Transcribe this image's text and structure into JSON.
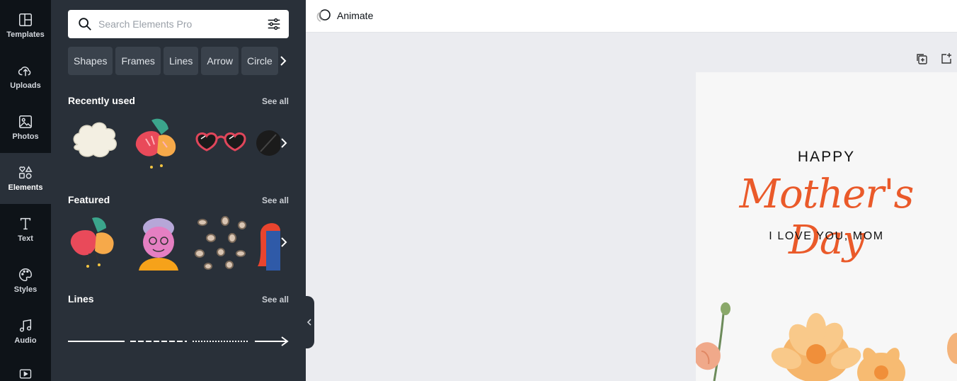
{
  "rail": {
    "items": [
      {
        "label": "Templates",
        "icon": "templates-icon"
      },
      {
        "label": "Uploads",
        "icon": "cloud-upload-icon"
      },
      {
        "label": "Photos",
        "icon": "image-icon"
      },
      {
        "label": "Elements",
        "icon": "shapes-icon",
        "active": true
      },
      {
        "label": "Text",
        "icon": "text-icon"
      },
      {
        "label": "Styles",
        "icon": "palette-icon"
      },
      {
        "label": "Audio",
        "icon": "music-note-icon"
      },
      {
        "label": "",
        "icon": "video-icon"
      }
    ]
  },
  "panel": {
    "search_placeholder": "Search Elements Pro",
    "chips": [
      "Shapes",
      "Frames",
      "Lines",
      "Arrow",
      "Circle"
    ],
    "sections": {
      "recent": {
        "title": "Recently used",
        "see_all": "See all"
      },
      "featured": {
        "title": "Featured",
        "see_all": "See all"
      },
      "lines": {
        "title": "Lines",
        "see_all": "See all"
      }
    }
  },
  "topbar": {
    "animate_label": "Animate"
  },
  "canvas": {
    "happy": "HAPPY",
    "headline": "Mother's Day",
    "subline": "I LOVE YOU, MOM"
  },
  "colors": {
    "rail_bg": "#0e1318",
    "panel_bg": "#293039",
    "accent_orange": "#ea5a2a",
    "canvas_bg": "#ebecf0"
  }
}
